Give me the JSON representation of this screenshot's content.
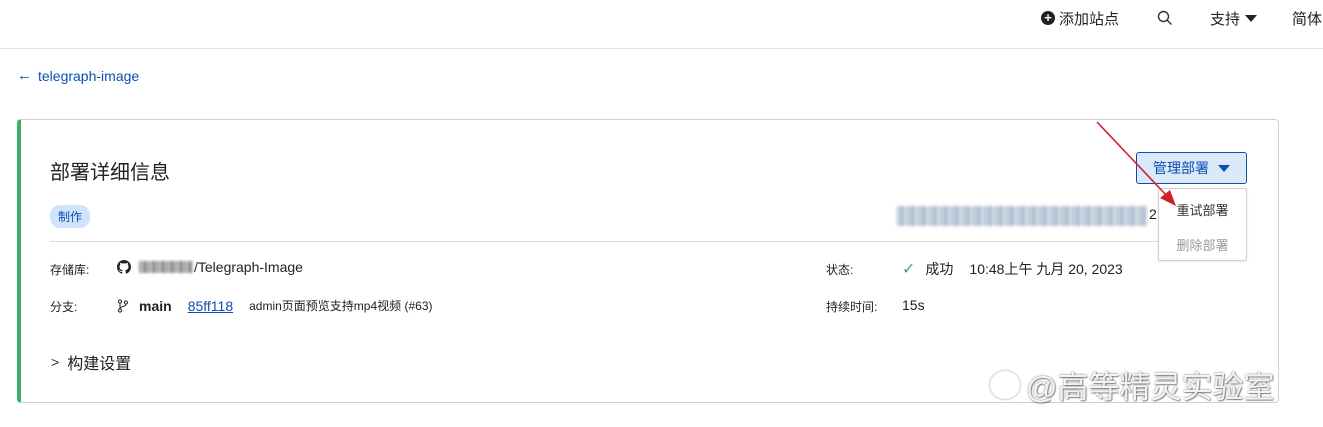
{
  "topbar": {
    "add_site": "添加站点",
    "support": "支持",
    "language": "简体"
  },
  "back": {
    "arrow": "←",
    "label": "telegraph-image"
  },
  "card": {
    "title": "部署详细信息",
    "badge": "制作",
    "url_tail": "2",
    "repo_label": "存储库:",
    "repo_value": "/Telegraph-Image",
    "branch_label": "分支:",
    "branch_name": "main",
    "commit_hash": "85ff118",
    "commit_message": "admin页面预览支持mp4视频 (#63)",
    "status_label": "状态:",
    "status_value": "成功",
    "status_time": "10:48上午 九月 20, 2023",
    "duration_label": "持续时间:",
    "duration_value": "15s",
    "build_settings": "构建设置"
  },
  "manage": {
    "button_label": "管理部署",
    "menu": [
      {
        "label": "重试部署",
        "enabled": true
      },
      {
        "label": "删除部署",
        "enabled": false
      }
    ]
  },
  "watermark": "@高等精灵实验室",
  "colors": {
    "accent": "#0a4eaf",
    "success": "#3cae6a",
    "badge_bg": "#cfe3fb",
    "annotation": "#d0212b"
  },
  "icons": [
    "plus-circle-icon",
    "search-icon",
    "caret-down-icon",
    "arrow-left-icon",
    "github-icon",
    "git-branch-icon",
    "check-icon",
    "chevron-right-icon"
  ]
}
